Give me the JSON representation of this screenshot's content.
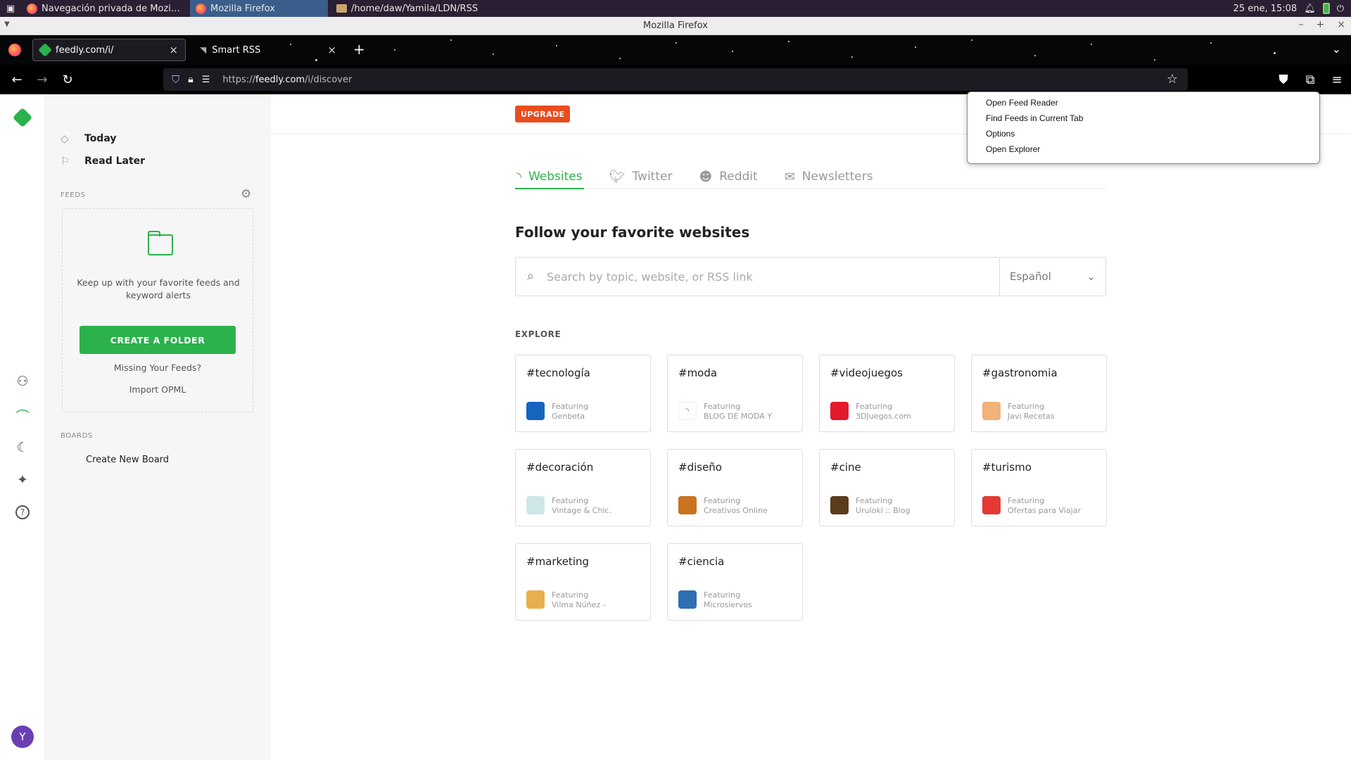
{
  "os": {
    "tasks": [
      "Navegación privada de Mozi…",
      "Mozilla Firefox",
      "/home/daw/Yamila/LDN/RSS"
    ],
    "clock": "25 ene, 15:08"
  },
  "window": {
    "title": "Mozilla Firefox"
  },
  "browser": {
    "tabs": [
      {
        "title": "feedly.com/i/"
      },
      {
        "title": "Smart RSS"
      }
    ],
    "url_prefix": "https://",
    "url_host": "feedly.com",
    "url_path": "/i/discover"
  },
  "ext_menu": {
    "items": [
      "Open Feed Reader",
      "Find Feeds in Current Tab",
      "Options",
      "Open Explorer"
    ]
  },
  "avatar": {
    "initial": "Y"
  },
  "sidebar": {
    "today": "Today",
    "read_later": "Read Later",
    "feeds_label": "FEEDS",
    "empty_text": "Keep up with your favorite feeds and keyword alerts",
    "create_folder": "CREATE A FOLDER",
    "missing_feeds": "Missing Your Feeds?",
    "import_opml": "Import OPML",
    "boards_label": "BOARDS",
    "create_board": "Create New Board"
  },
  "main": {
    "upgrade": "UPGRADE",
    "tabs": [
      "Websites",
      "Twitter",
      "Reddit",
      "Newsletters"
    ],
    "heading": "Follow your favorite websites",
    "search_placeholder": "Search by topic, website, or RSS link",
    "language": "Español",
    "explore_label": "EXPLORE",
    "cards": [
      {
        "tag": "#tecnología",
        "featuring": "Featuring",
        "source": "Genbeta",
        "color": "#1565c0"
      },
      {
        "tag": "#moda",
        "featuring": "Featuring",
        "source": "BLOG DE MODA Y",
        "color": "#ffffff"
      },
      {
        "tag": "#videojuegos",
        "featuring": "Featuring",
        "source": "3DJuegos.com",
        "color": "#e3192c"
      },
      {
        "tag": "#gastronomia",
        "featuring": "Featuring",
        "source": "Javi Recetas",
        "color": "#f2b27a"
      },
      {
        "tag": "#decoración",
        "featuring": "Featuring",
        "source": "Vintage & Chic.",
        "color": "#cfe7e9"
      },
      {
        "tag": "#diseño",
        "featuring": "Featuring",
        "source": "Creativos Online",
        "color": "#c8741f"
      },
      {
        "tag": "#cine",
        "featuring": "Featuring",
        "source": "Uruloki :: Blog",
        "color": "#5a3b1a"
      },
      {
        "tag": "#turismo",
        "featuring": "Featuring",
        "source": "Ofertas para Viajar",
        "color": "#e53935"
      },
      {
        "tag": "#marketing",
        "featuring": "Featuring",
        "source": "Vilma Núñez –",
        "color": "#e8b04a"
      },
      {
        "tag": "#ciencia",
        "featuring": "Featuring",
        "source": "Microsiervos",
        "color": "#2f6fb3"
      }
    ]
  }
}
